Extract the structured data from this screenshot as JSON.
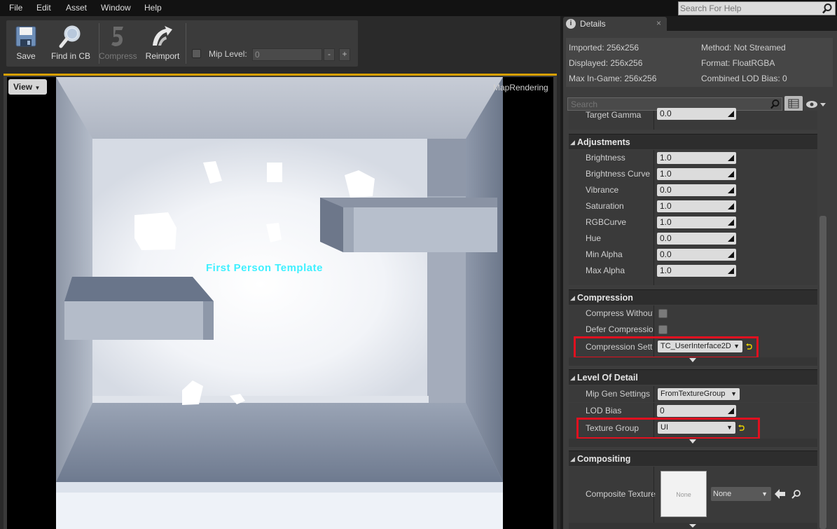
{
  "menu": [
    "File",
    "Edit",
    "Asset",
    "Window",
    "Help"
  ],
  "help_search": {
    "placeholder": "Search For Help"
  },
  "toolbar": {
    "save": "Save",
    "find_in_cb": "Find in CB",
    "compress": "Compress",
    "reimport": "Reimport",
    "mip_level_label": "Mip Level:",
    "mip_level_value": "0",
    "minus": "-",
    "plus": "+"
  },
  "viewport": {
    "view_button": "View",
    "overlay_label": "MapRendering",
    "scene_text": "First Person Template"
  },
  "details_tab": {
    "title": "Details",
    "close": "×"
  },
  "info": {
    "imported": "Imported: 256x256",
    "displayed": "Displayed: 256x256",
    "max_in_game": "Max In-Game: 256x256",
    "method": "Method: Not Streamed",
    "format": "Format: FloatRGBA",
    "combined_lod_bias": "Combined LOD Bias: 0"
  },
  "search": {
    "placeholder": "Search"
  },
  "partial_row": {
    "name": "Target Gamma",
    "value": "0.0"
  },
  "adjustments": {
    "title": "Adjustments",
    "rows": [
      {
        "name": "Brightness",
        "value": "1.0"
      },
      {
        "name": "Brightness Curve",
        "value": "1.0"
      },
      {
        "name": "Vibrance",
        "value": "0.0"
      },
      {
        "name": "Saturation",
        "value": "1.0"
      },
      {
        "name": "RGBCurve",
        "value": "1.0"
      },
      {
        "name": "Hue",
        "value": "0.0"
      },
      {
        "name": "Min Alpha",
        "value": "0.0"
      },
      {
        "name": "Max Alpha",
        "value": "1.0"
      }
    ]
  },
  "compression": {
    "title": "Compression",
    "compress_without_alpha": "Compress Without",
    "defer_compression": "Defer Compression",
    "compression_settings": "Compression Setti",
    "compression_settings_value": "TC_UserInterface2D"
  },
  "lod": {
    "title": "Level Of Detail",
    "mip_gen_settings": "Mip Gen Settings",
    "mip_gen_value": "FromTextureGroup",
    "lod_bias": "LOD Bias",
    "lod_bias_value": "0",
    "texture_group": "Texture Group",
    "texture_group_value": "UI"
  },
  "compositing": {
    "title": "Compositing",
    "composite_texture": "Composite Texture",
    "thumb_text": "None",
    "combo_value": "None"
  }
}
